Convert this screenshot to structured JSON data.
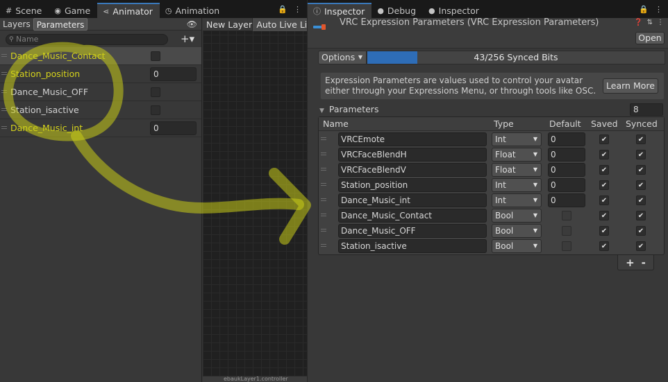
{
  "colors": {
    "accent": "#3a79bb",
    "bits_fill": "#2e6db7",
    "annotation_highlight": "#c8cc18",
    "param_name_yellow": "#d7d41c"
  },
  "animator_window": {
    "tabs": [
      {
        "label": "Scene",
        "icon": "grid-icon"
      },
      {
        "label": "Game",
        "icon": "gamepad-icon"
      },
      {
        "label": "Animator",
        "icon": "animator-icon"
      },
      {
        "label": "Animation",
        "icon": "clock-icon"
      }
    ],
    "subtabs": {
      "layers": "Layers",
      "parameters": "Parameters"
    },
    "search": {
      "placeholder": "Name"
    },
    "parameters": [
      {
        "name": "Dance_Music_Contact",
        "type": "bool",
        "value": false
      },
      {
        "name": "Station_position",
        "type": "int",
        "value": "0"
      },
      {
        "name": "Dance_Music_OFF",
        "type": "bool",
        "value": false
      },
      {
        "name": "Station_isactive",
        "type": "bool",
        "value": false
      },
      {
        "name": "Dance_Music_int",
        "type": "int",
        "value": "0"
      }
    ],
    "graph": {
      "layer_tab": "New Layer",
      "auto_live": "Auto Live Li",
      "footer": "ebaukLayer1.controller"
    }
  },
  "inspector_window": {
    "tabs": [
      {
        "label": "Inspector",
        "icon": "info-icon"
      },
      {
        "label": "Debug",
        "icon": "dot-icon"
      },
      {
        "label": "Inspector",
        "icon": "dot-icon"
      }
    ],
    "component_title": "VRC Expression Parameters (VRC Expression Parameters)",
    "open_label": "Open",
    "options_label": "Options",
    "synced_bits": {
      "used": 43,
      "total": 256,
      "label": "43/256 Synced Bits"
    },
    "help_text": "Expression Parameters are values used to control your avatar either through your Expressions Menu, or through tools like OSC.",
    "learn_more_label": "Learn More",
    "section_label": "Parameters",
    "param_count": "8",
    "columns": {
      "name": "Name",
      "type": "Type",
      "default": "Default",
      "saved": "Saved",
      "synced": "Synced"
    },
    "rows": [
      {
        "name": "VRCEmote",
        "type": "Int",
        "default": "0",
        "saved": true,
        "synced": true
      },
      {
        "name": "VRCFaceBlendH",
        "type": "Float",
        "default": "0",
        "saved": true,
        "synced": true
      },
      {
        "name": "VRCFaceBlendV",
        "type": "Float",
        "default": "0",
        "saved": true,
        "synced": true
      },
      {
        "name": "Station_position",
        "type": "Int",
        "default": "0",
        "saved": true,
        "synced": true
      },
      {
        "name": "Dance_Music_int",
        "type": "Int",
        "default": "0",
        "saved": true,
        "synced": true
      },
      {
        "name": "Dance_Music_Contact",
        "type": "Bool",
        "default": false,
        "saved": true,
        "synced": true
      },
      {
        "name": "Dance_Music_OFF",
        "type": "Bool",
        "default": false,
        "saved": true,
        "synced": true
      },
      {
        "name": "Station_isactive",
        "type": "Bool",
        "default": false,
        "saved": true,
        "synced": true
      }
    ],
    "add_label": "+",
    "remove_label": "-"
  }
}
